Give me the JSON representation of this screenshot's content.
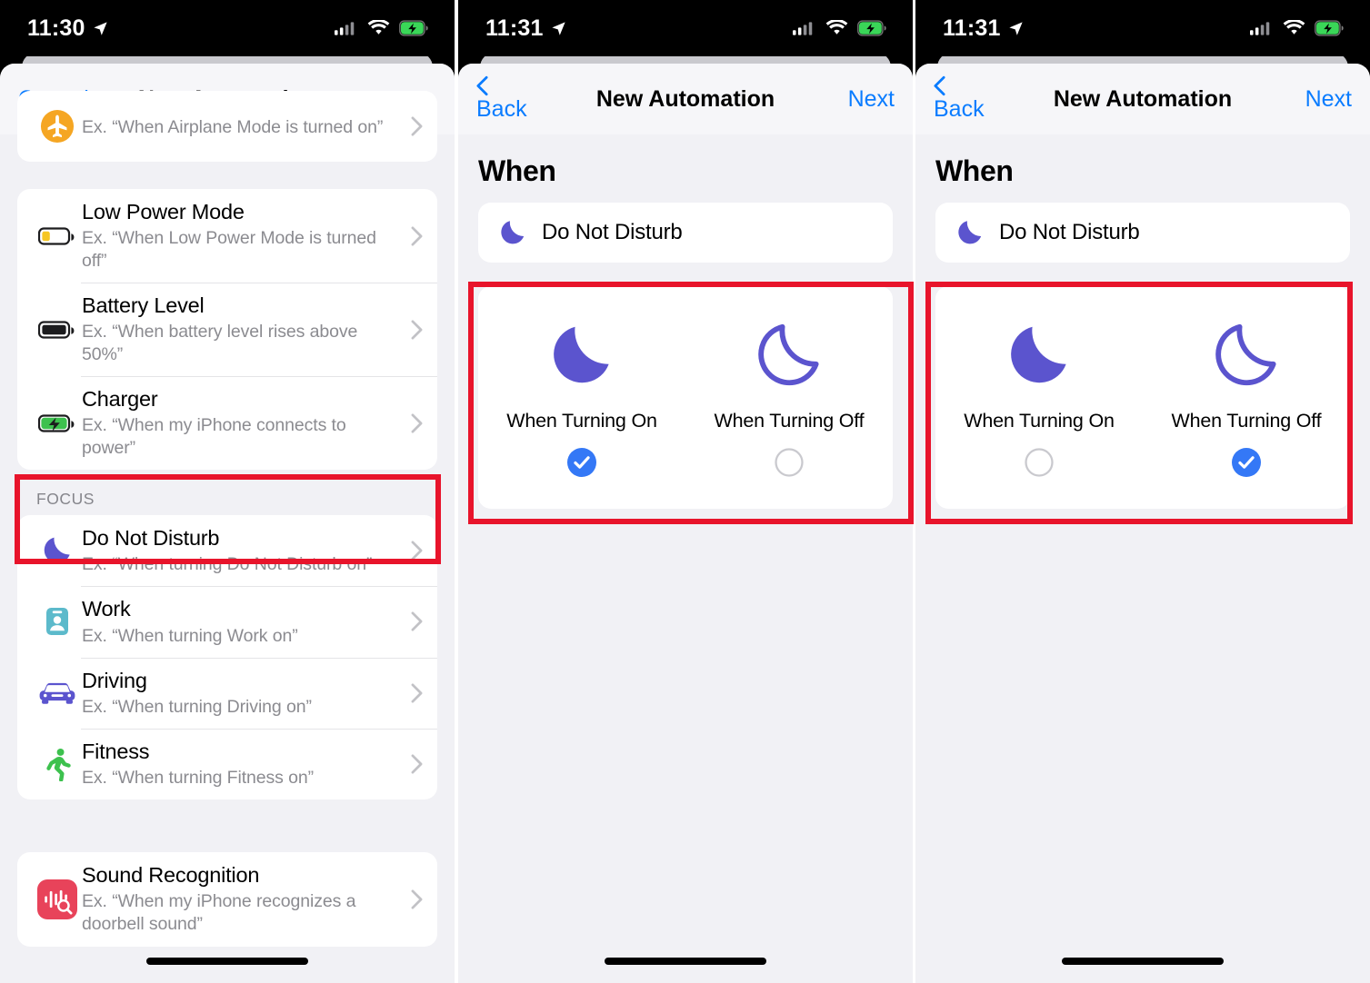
{
  "panels": [
    {
      "id": "trigger-picker",
      "statusbar": {
        "time": "11:30",
        "location_icon": "location-arrow-icon",
        "cellular_icon": "cellular-signal-icon",
        "wifi_icon": "wifi-icon",
        "battery_icon": "battery-charging-icon"
      },
      "nav": {
        "left_label": "Cancel",
        "title": "New Automation",
        "right_label": ""
      },
      "partial_row": {
        "title": "",
        "subtitle": "Ex. “When Airplane Mode is turned on”",
        "icon": "airplane-mode-icon"
      },
      "groups": [
        {
          "header": "",
          "rows": [
            {
              "title": "Low Power Mode",
              "subtitle": "Ex. “When Low Power Mode is turned off”",
              "icon": "battery-low-icon"
            },
            {
              "title": "Battery Level",
              "subtitle": "Ex. “When battery level rises above 50%”",
              "icon": "battery-full-icon"
            },
            {
              "title": "Charger",
              "subtitle": "Ex. “When my iPhone connects to power”",
              "icon": "battery-charging-green-icon"
            }
          ]
        },
        {
          "header": "Focus",
          "rows": [
            {
              "title": "Do Not Disturb",
              "subtitle": "Ex. “When turning Do Not Disturb on”",
              "icon": "moon-icon",
              "highlighted": true
            },
            {
              "title": "Work",
              "subtitle": "Ex. “When turning Work on”",
              "icon": "work-badge-icon"
            },
            {
              "title": "Driving",
              "subtitle": "Ex. “When turning Driving on”",
              "icon": "car-icon"
            },
            {
              "title": "Fitness",
              "subtitle": "Ex. “When turning Fitness on”",
              "icon": "running-person-icon"
            }
          ]
        },
        {
          "header": "",
          "rows": [
            {
              "title": "Sound Recognition",
              "subtitle": "Ex. “When my iPhone recognizes a doorbell sound”",
              "icon": "sound-recognition-icon"
            }
          ]
        }
      ]
    },
    {
      "id": "when-turning-on-selected",
      "statusbar": {
        "time": "11:31",
        "location_icon": "location-arrow-icon",
        "cellular_icon": "cellular-signal-icon",
        "wifi_icon": "wifi-icon",
        "battery_icon": "battery-charging-icon"
      },
      "nav": {
        "left_label": "Back",
        "title": "New Automation",
        "right_label": "Next"
      },
      "section_title": "When",
      "trigger": {
        "label": "Do Not Disturb",
        "icon": "moon-icon"
      },
      "choices": [
        {
          "label": "When Turning On",
          "icon": "moon-filled-icon",
          "selected": true
        },
        {
          "label": "When Turning Off",
          "icon": "moon-outline-icon",
          "selected": false
        }
      ]
    },
    {
      "id": "when-turning-off-selected",
      "statusbar": {
        "time": "11:31",
        "location_icon": "location-arrow-icon",
        "cellular_icon": "cellular-signal-icon",
        "wifi_icon": "wifi-icon",
        "battery_icon": "battery-charging-icon"
      },
      "nav": {
        "left_label": "Back",
        "title": "New Automation",
        "right_label": "Next"
      },
      "section_title": "When",
      "trigger": {
        "label": "Do Not Disturb",
        "icon": "moon-icon"
      },
      "choices": [
        {
          "label": "When Turning On",
          "icon": "moon-filled-icon",
          "selected": false
        },
        {
          "label": "When Turning Off",
          "icon": "moon-outline-icon",
          "selected": true
        }
      ]
    }
  ],
  "colors": {
    "accent_blue": "#0a7cff",
    "selected_blue": "#3478f6",
    "focus_purple": "#5b54ce",
    "annotation_red": "#e8142b",
    "page_bg": "#f1f1f5",
    "card_white": "#ffffff",
    "subtitle_gray": "#8b8b90",
    "work_teal": "#5cbacb",
    "fitness_green": "#3dc14e",
    "sound_red": "#e8435a",
    "battery_green": "#3ad658",
    "low_power_yellow": "#f6c623"
  }
}
